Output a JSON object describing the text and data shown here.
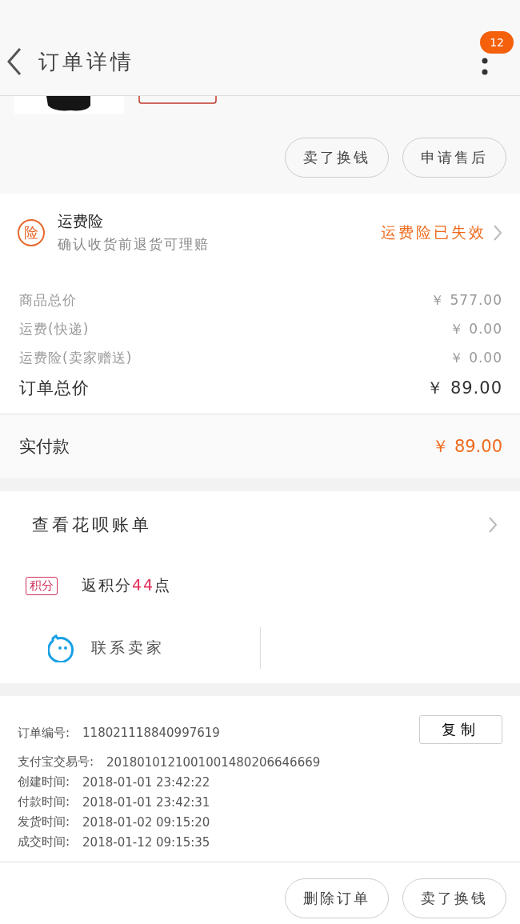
{
  "nav": {
    "title": "订单详情",
    "badge": "12"
  },
  "product": {
    "kind": "picture"
  },
  "item_actions": [
    "卖了换钱",
    "申请售后"
  ],
  "insurance": {
    "icon_text": "险",
    "title": "运费险",
    "subtitle": "确认收货前退货可理赔",
    "status": "运费险已失效"
  },
  "price_rows": [
    {
      "label": "商品总价",
      "value": "￥ 577.00"
    },
    {
      "label": "运费(快递)",
      "value": "￥ 0.00"
    },
    {
      "label": "运费险(卖家赠送)",
      "value": "￥ 0.00"
    }
  ],
  "total": {
    "label": "订单总价",
    "value": "￥ 89.00"
  },
  "paid": {
    "label": "实付款",
    "value": "￥ 89.00"
  },
  "huabei": {
    "label": "查看花呗账单"
  },
  "points": {
    "tag": "积分",
    "text": "返积分**44**点"
  },
  "contact": {
    "label": "联系卖家"
  },
  "order_info": {
    "copy_button": "复制",
    "rows": [
      {
        "label": "订单编号:",
        "value": "118021118840997619"
      },
      {
        "label": "支付宝交易号:",
        "value": "2018010121001001480206646669"
      },
      {
        "label": "创建时间:",
        "value": "2018-01-01 23:42:22"
      },
      {
        "label": "付款时间:",
        "value": "2018-01-01 23:42:31"
      },
      {
        "label": "发货时间:",
        "value": "2018-01-02 09:15:20"
      },
      {
        "label": "成交时间:",
        "value": "2018-01-12 09:15:35"
      }
    ]
  },
  "bottom_actions": [
    "删除订单",
    "卖了换钱"
  ]
}
